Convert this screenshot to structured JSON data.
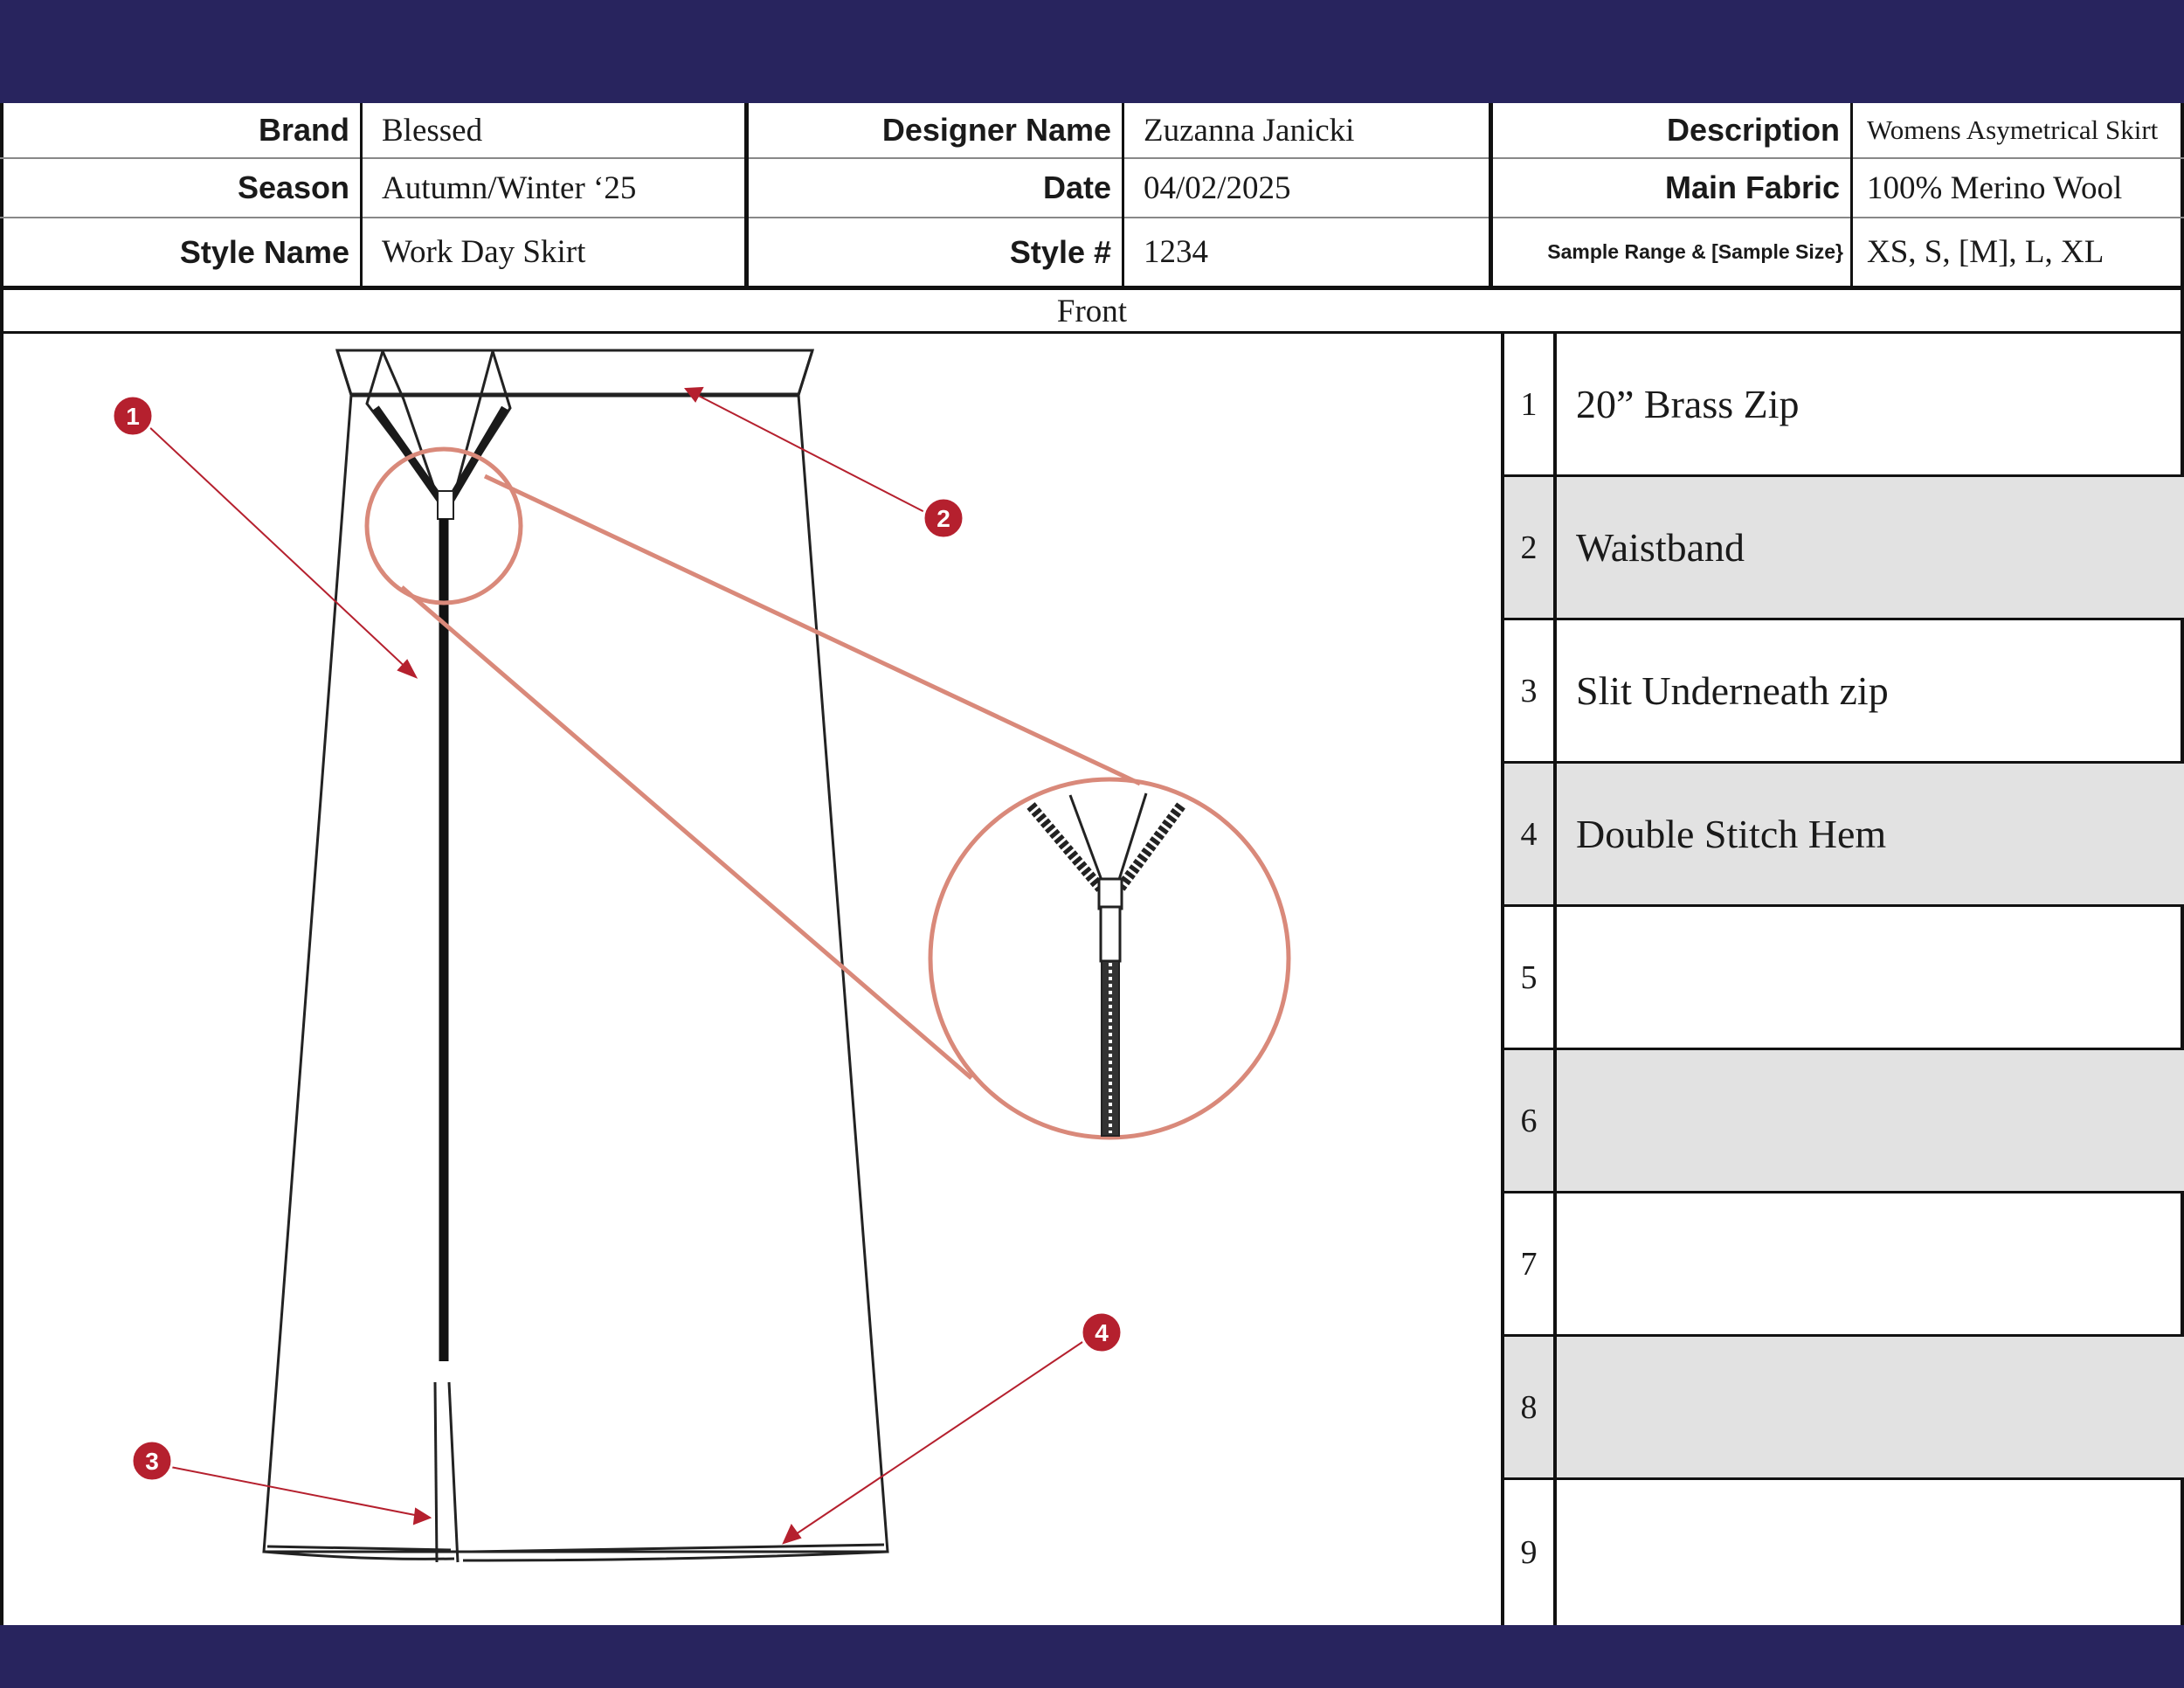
{
  "header": {
    "row1": {
      "brand_label": "Brand",
      "brand": "Blessed",
      "designer_label": "Designer Name",
      "designer": "Zuzanna Janicki",
      "description_label": "Description",
      "description": "Womens Asymetrical Skirt"
    },
    "row2": {
      "season_label": "Season",
      "season": "Autumn/Winter  ‘25",
      "date_label": "Date",
      "date": "04/02/2025",
      "fabric_label": "Main Fabric",
      "fabric": "100% Merino Wool"
    },
    "row3": {
      "style_name_label": "Style Name",
      "style_name": "Work Day Skirt",
      "style_no_label": "Style #",
      "style_no": "1234",
      "sample_label": "Sample Range  & [Sample Size}",
      "sample": "XS,  S, [M], L, XL"
    }
  },
  "view_label": "Front",
  "callout_markers": [
    "1",
    "2",
    "3",
    "4"
  ],
  "legend": [
    {
      "num": "1",
      "text": "20” Brass Zip"
    },
    {
      "num": "2",
      "text": "Waistband"
    },
    {
      "num": "3",
      "text": "Slit Underneath zip"
    },
    {
      "num": "4",
      "text": "Double Stitch Hem"
    },
    {
      "num": "5",
      "text": ""
    },
    {
      "num": "6",
      "text": ""
    },
    {
      "num": "7",
      "text": ""
    },
    {
      "num": "8",
      "text": ""
    },
    {
      "num": "9",
      "text": ""
    }
  ],
  "colors": {
    "band": "#28245e",
    "callout": "#b5202e",
    "magnifier": "#d9897a",
    "shade": "#e2e2e2"
  }
}
